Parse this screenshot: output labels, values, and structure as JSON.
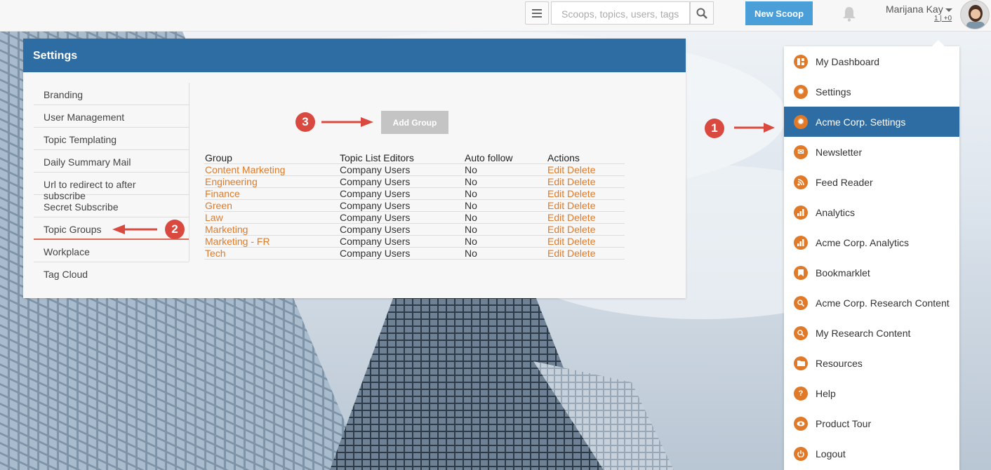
{
  "topbar": {
    "search_placeholder": "Scoops, topics, users, tags",
    "new_scoop_label": "New Scoop",
    "username": "Marijana Kay",
    "user_counts": "1 | +0"
  },
  "settings": {
    "title": "Settings",
    "sidebar": [
      {
        "label": "Branding"
      },
      {
        "label": "User Management"
      },
      {
        "label": "Topic Templating"
      },
      {
        "label": "Daily Summary Mail"
      },
      {
        "label": "Url to redirect to after subscribe"
      },
      {
        "label": "Secret Subscribe"
      },
      {
        "label": "Topic Groups"
      },
      {
        "label": "Workplace"
      },
      {
        "label": "Tag Cloud"
      }
    ],
    "add_group_label": "Add Group",
    "table": {
      "headers": [
        "Group",
        "Topic List Editors",
        "Auto follow",
        "Actions"
      ],
      "edit_label": "Edit",
      "delete_label": "Delete",
      "rows": [
        {
          "group": "Content Marketing",
          "editors": "Company Users",
          "auto": "No"
        },
        {
          "group": "Engineering",
          "editors": "Company Users",
          "auto": "No"
        },
        {
          "group": "Finance",
          "editors": "Company Users",
          "auto": "No"
        },
        {
          "group": "Green",
          "editors": "Company Users",
          "auto": "No"
        },
        {
          "group": "Law",
          "editors": "Company Users",
          "auto": "No"
        },
        {
          "group": "Marketing",
          "editors": "Company Users",
          "auto": "No"
        },
        {
          "group": "Marketing - FR",
          "editors": "Company Users",
          "auto": "No"
        },
        {
          "group": "Tech",
          "editors": "Company Users",
          "auto": "No"
        }
      ]
    }
  },
  "dropdown": {
    "items": [
      {
        "label": "My Dashboard",
        "icon": "dashboard-icon"
      },
      {
        "label": "Settings",
        "icon": "gear-icon"
      },
      {
        "label": "Acme Corp. Settings",
        "icon": "gear-icon"
      },
      {
        "label": "Newsletter",
        "icon": "envelope-icon"
      },
      {
        "label": "Feed Reader",
        "icon": "rss-icon"
      },
      {
        "label": "Analytics",
        "icon": "bar-chart-icon"
      },
      {
        "label": "Acme Corp. Analytics",
        "icon": "bar-chart-icon"
      },
      {
        "label": "Bookmarklet",
        "icon": "bookmark-icon"
      },
      {
        "label": "Acme Corp. Research Content",
        "icon": "search-icon"
      },
      {
        "label": "My Research Content",
        "icon": "search-icon"
      },
      {
        "label": "Resources",
        "icon": "folder-icon"
      },
      {
        "label": "Help",
        "icon": "question-icon"
      },
      {
        "label": "Product Tour",
        "icon": "eye-icon"
      },
      {
        "label": "Logout",
        "icon": "power-icon"
      }
    ]
  },
  "annotations": {
    "badge1": "1",
    "badge2": "2",
    "badge3": "3"
  },
  "colors": {
    "header_blue": "#2e6da4",
    "accent_orange": "#e07a28",
    "button_blue": "#4a9fd8",
    "annotation_red": "#d9493f"
  }
}
